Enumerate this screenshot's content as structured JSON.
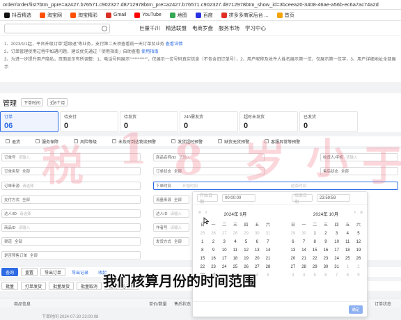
{
  "browser": {
    "url": "order/order/list?btm_ppre=a2427.b76571.c902327.d8712978btm_pre=a2427.b76571.c902327.d8712978btm_show_id=3bceea20-3408-46ae-a56b-ec6a7ac74a2d",
    "bookmarks": [
      {
        "label": "抖音精选",
        "icon": "douyin-icon",
        "color": "#111111"
      },
      {
        "label": "淘宝网",
        "icon": "taobao-icon",
        "color": "#ff5000"
      },
      {
        "label": "淘宝精彩",
        "icon": "taobao-icon",
        "color": "#ff5000"
      },
      {
        "label": "Gmail",
        "icon": "gmail-icon",
        "color": "#d93025"
      },
      {
        "label": "YouTube",
        "icon": "youtube-icon",
        "color": "#ff0000"
      },
      {
        "label": "地图",
        "icon": "maps-icon",
        "color": "#34a853"
      },
      {
        "label": "百度",
        "icon": "baidu-icon",
        "color": "#2932e1"
      },
      {
        "label": "拼多多商家后台 ...",
        "icon": "pdd-icon",
        "color": "#e02e24"
      },
      {
        "label": "首页",
        "icon": "home-icon",
        "color": "#f4a300"
      }
    ]
  },
  "topnav": {
    "links": [
      "巨量千川",
      "精选联盟",
      "电商罗盘",
      "服务市场",
      "学习中心"
    ]
  },
  "notice": {
    "lines": [
      "1、2023/1/1起，平台升级订单\"超级退\"等业务，支付第二天须查看前一天订单及业务",
      "2、订单管理使用过程中如遇问题，建议优先通过「使用指南」自助查看",
      "3、为进一步提升用户隐私，页面显示有所调整：1、电话号码展示\"*********\"，仅展示一位号码真实信息（不包含旧订单号），2、用户昵称及收件人姓名展示第一位，仅展示第一位字，3、用户详细地址全部展示"
    ],
    "guide_link": "使用指南",
    "more_link": "查看详情"
  },
  "page": {
    "title": "管理",
    "time_filter_label": "下单时间",
    "time_filter_value": "近6个月"
  },
  "cards": [
    {
      "label": "订单",
      "value": "06",
      "active": true
    },
    {
      "label": "待支付",
      "value": "0",
      "active": false
    },
    {
      "label": "待发货",
      "value": "0",
      "active": false
    },
    {
      "label": "24h需发货",
      "value": "0",
      "active": false
    },
    {
      "label": "超时未发货",
      "value": "0",
      "active": false
    },
    {
      "label": "已发货",
      "value": "0",
      "active": false
    }
  ],
  "subtabs": [
    "退货",
    "服务保障",
    "风险等级",
    "未及时到达物流预警",
    "发货超时预警",
    "缺货无货预警",
    "客服异常等预警"
  ],
  "form": {
    "r1": [
      {
        "label": "订单号",
        "ph": "请输入"
      },
      {
        "label": "商品名称/ID",
        "ph": "请输入"
      },
      {
        "label": "收货人/手机",
        "ph": "请输入"
      }
    ],
    "r2": [
      {
        "label": "订单类型",
        "val": "全部"
      },
      {
        "label": "订单状态",
        "val": "全部"
      },
      {
        "label": "售后状态",
        "val": "全部"
      }
    ],
    "r3": [
      {
        "label": "订单来源",
        "ph": "请选择"
      },
      {
        "label": "下单时间",
        "ph": "开始时间"
      },
      {
        "label": "结束时间",
        "ph": "结束时间"
      }
    ],
    "r4": [
      {
        "label": "支付方式",
        "val": "全部"
      },
      {
        "label": "流量来源",
        "val": "全部"
      }
    ],
    "r5": [
      {
        "label": "达人/ID",
        "ph": "请选择"
      },
      {
        "label": "达人ID",
        "ph": "请输入"
      }
    ],
    "r6": [
      {
        "label": "商品ID",
        "ph": "请输入"
      },
      {
        "label": "作者号",
        "ph": "请输入"
      }
    ],
    "r7": [
      {
        "label": "渠道",
        "val": "全部"
      },
      {
        "label": "发货方式",
        "val": "全部"
      }
    ],
    "r8": [
      {
        "label": "是否预售订单",
        "val": "全部"
      }
    ]
  },
  "picker": {
    "start_date_ph": "开始日期",
    "start_time": "00:00:00",
    "end_date_ph": "结束日期",
    "end_time": "23:59:59",
    "left_title": "2024年 9月",
    "right_title": "2024年 10月",
    "weekdays": [
      "日",
      "一",
      "二",
      "三",
      "四",
      "五",
      "六"
    ],
    "left_days": [
      "25",
      "26",
      "27",
      "28",
      "29",
      "30",
      "31",
      "1",
      "2",
      "3",
      "4",
      "5",
      "6",
      "7",
      "8",
      "9",
      "10",
      "11",
      "12",
      "13",
      "14",
      "15",
      "16",
      "17",
      "18",
      "19",
      "20",
      "21",
      "22",
      "23",
      "24",
      "25",
      "26",
      "27",
      "28",
      "29",
      "30",
      "1",
      "2",
      "3",
      "4",
      "5"
    ],
    "right_days": [
      "29",
      "30",
      "1",
      "2",
      "3",
      "4",
      "5",
      "6",
      "7",
      "8",
      "9",
      "10",
      "11",
      "12",
      "13",
      "14",
      "15",
      "16",
      "17",
      "18",
      "19",
      "20",
      "21",
      "22",
      "23",
      "24",
      "25",
      "26",
      "27",
      "28",
      "29",
      "30",
      "31",
      "1",
      "2",
      "3",
      "4",
      "5",
      "6",
      "7",
      "8",
      "9"
    ],
    "ok_label": "确定"
  },
  "buttons": {
    "row1": [
      "查询",
      "重置",
      "导出订单",
      "导出记录",
      "收起"
    ],
    "row2": [
      "批量",
      "打单发货",
      "批量发货",
      "批量取消",
      "批量备注/旗帜"
    ]
  },
  "table": {
    "headers": [
      "商品信息",
      "单价/数量",
      "售后状态",
      "订单状态"
    ],
    "first_row_date": "下单时间 2024-07-30 23:00:08"
  },
  "overlay": {
    "subtitle": "我们核算月份的时间范围",
    "watermark": "税 1 8 岁 小 于"
  }
}
